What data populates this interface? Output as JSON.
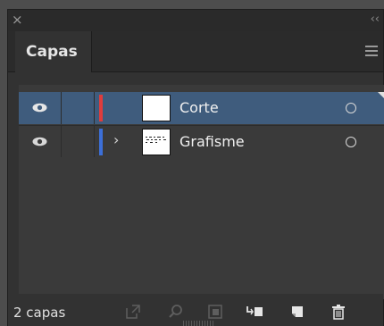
{
  "window": {
    "close_glyph": "×",
    "collapse_glyph": "‹‹"
  },
  "tabs": [
    {
      "label": "Capas",
      "active": true
    }
  ],
  "layers": [
    {
      "name": "Corte",
      "visible": true,
      "color": "#e03c3c",
      "expandable": false,
      "selected": true,
      "thumbnail": "blank"
    },
    {
      "name": "Grafisme",
      "visible": true,
      "color": "#3c6fd8",
      "expandable": true,
      "selected": false,
      "thumbnail": "dots"
    }
  ],
  "footer": {
    "count_label": "2 capas",
    "icons": [
      "export-icon",
      "locate-object-icon",
      "clipping-mask-icon",
      "new-sublayer-icon",
      "new-layer-icon",
      "trash-icon"
    ]
  },
  "colors": {
    "panel_bg": "#323232",
    "selection": "#3f5c7d",
    "layer_red": "#e03c3c",
    "layer_blue": "#3c6fd8"
  }
}
